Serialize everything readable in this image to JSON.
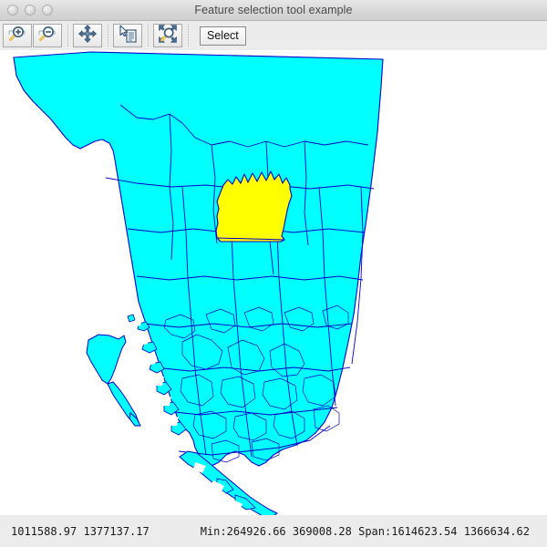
{
  "window": {
    "title": "Feature selection tool example",
    "controls": [
      {
        "name": "close-button",
        "label": "close"
      },
      {
        "name": "minimize-button",
        "label": "minimize"
      },
      {
        "name": "zoom-button",
        "label": "maximize"
      }
    ]
  },
  "toolbar": {
    "buttons": [
      {
        "name": "zoom-in-button",
        "icon": "magnifier-plus-icon",
        "tooltip": "Zoom In"
      },
      {
        "name": "zoom-out-button",
        "icon": "magnifier-minus-icon",
        "tooltip": "Zoom Out"
      },
      {
        "name": "pan-button",
        "icon": "four-arrows-pan-icon",
        "tooltip": "Pan"
      },
      {
        "name": "info-button",
        "icon": "cursor-document-icon",
        "tooltip": "Info"
      },
      {
        "name": "zoom-full-button",
        "icon": "magnifier-expand-icon",
        "tooltip": "Zoom to Full Extent"
      }
    ],
    "select_label": "Select"
  },
  "statusbar": {
    "cursor_x": "1011588.97",
    "cursor_y": "1377137.17",
    "coords_text": "1011588.97 1377137.17",
    "extent_text": "Min:264926.66 369008.28 Span:1614623.54 1366634.62",
    "min_label": "Min:",
    "min_x": "264926.66",
    "min_y": "369008.28",
    "span_label": "Span:",
    "span_x": "1614623.54",
    "span_y": "1366634.62"
  },
  "map": {
    "name": "british-columbia-regional-districts",
    "background_color": "#ffffff",
    "fill_color": "#00ffff",
    "stroke_color": "#0000cd",
    "selected_fill_color": "#ffff00",
    "selected_feature": "selected-region-polygon"
  }
}
